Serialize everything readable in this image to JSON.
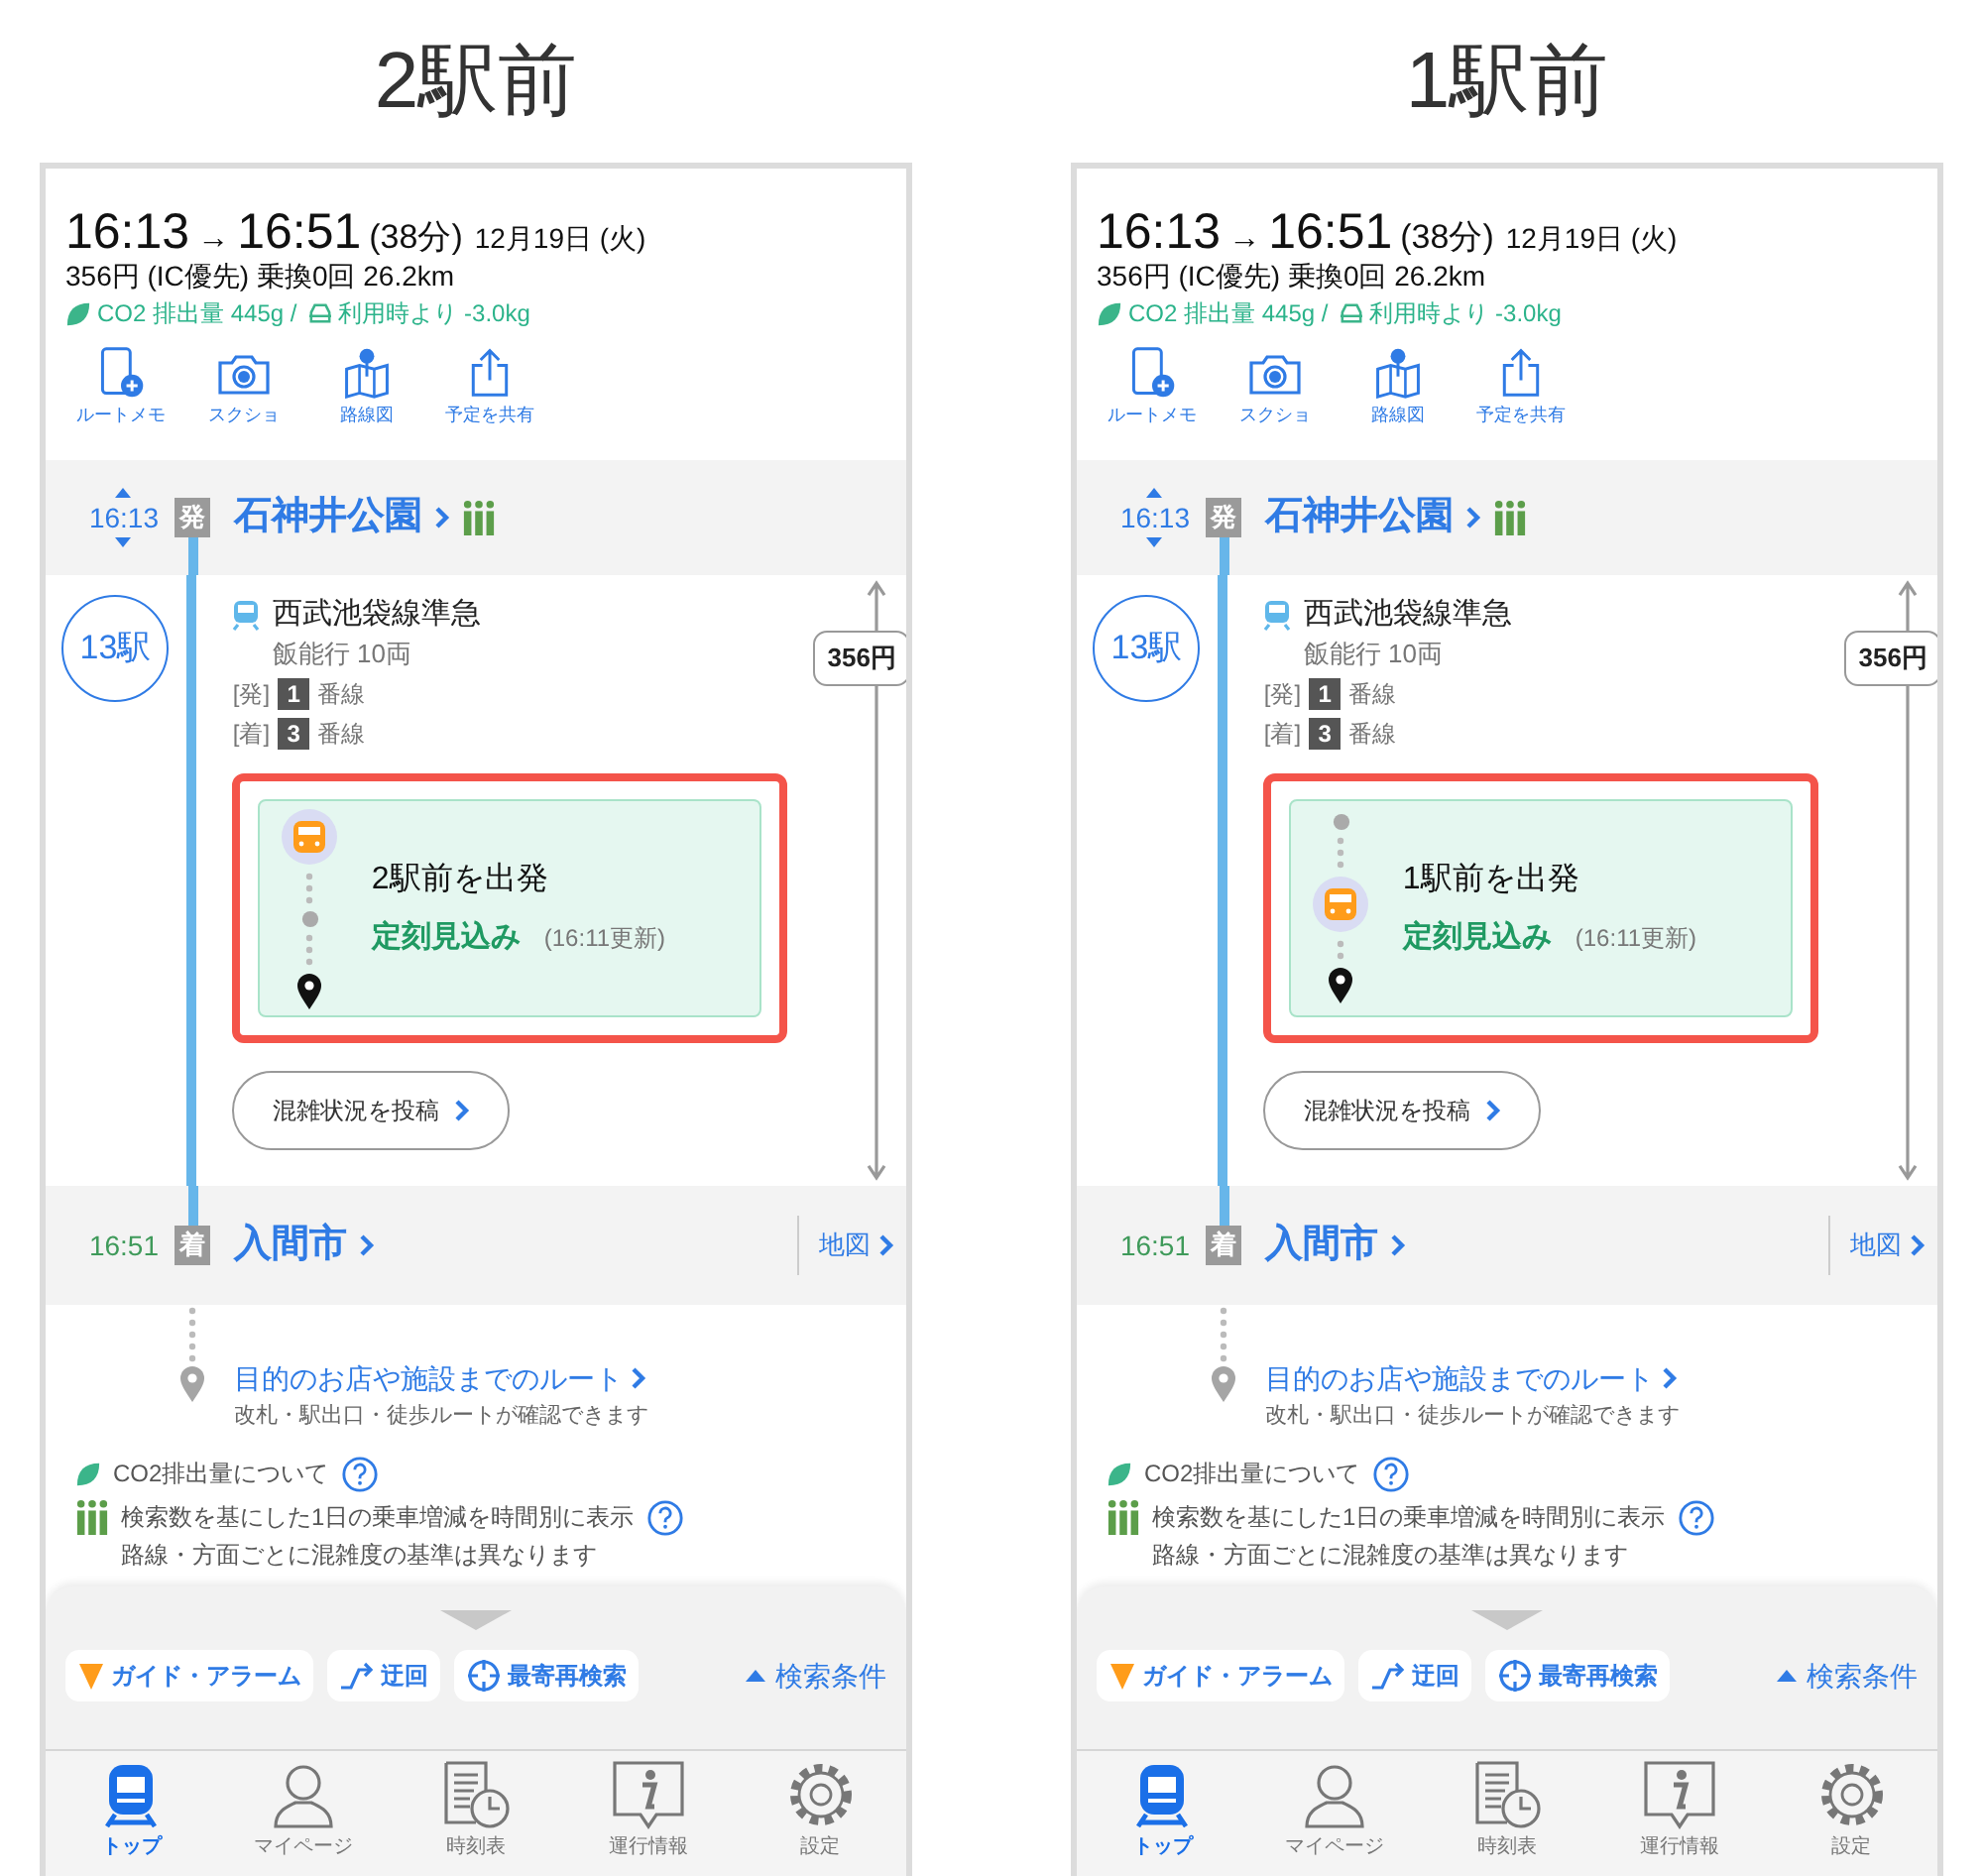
{
  "panels": [
    {
      "heading": "2駅前",
      "summary": {
        "depart": "16:13",
        "arrow": "→",
        "arrive": "16:51",
        "duration": "(38分)",
        "date": "12月19日 (火)",
        "fare": "356円 (IC優先) 乗換0回 26.2km",
        "co2": "CO2 排出量 445g /",
        "co2_saving": "利用時より -3.0kg"
      },
      "actions": [
        {
          "kind": "memo",
          "label": "ルートメモ"
        },
        {
          "kind": "camera",
          "label": "スクショ"
        },
        {
          "kind": "map",
          "label": "路線図"
        },
        {
          "kind": "share",
          "label": "予定を共有"
        }
      ],
      "departure": {
        "time": "16:13",
        "badge": "発",
        "station": "石神井公園"
      },
      "train": {
        "stops": "13駅",
        "line": "西武池袋線準急",
        "destination": "飯能行 10両",
        "platforms": [
          {
            "prefix": "[発]",
            "number": "1",
            "suffix": "番線"
          },
          {
            "prefix": "[着]",
            "number": "3",
            "suffix": "番線"
          }
        ],
        "fare": "356円"
      },
      "live": {
        "kind": "far",
        "status": "2駅前を出発",
        "punctuality": "定刻見込み",
        "updated": "(16:11更新)",
        "highlighted": true
      },
      "congestion_button": "混雑状況を投稿",
      "arrival": {
        "time": "16:51",
        "badge": "着",
        "station": "入間市",
        "map_link": "地図"
      },
      "destination_route": {
        "title": "目的のお店や施設までのルート",
        "subtitle": "改札・駅出口・徒歩ルートが確認できます"
      },
      "notes": [
        {
          "kind": "co2",
          "lines": [
            "CO2排出量について"
          ]
        },
        {
          "kind": "crowd",
          "lines": [
            "検索数を基にした1日の乗車増減を時間別に表示",
            "路線・方面ごとに混雑度の基準は異なります"
          ]
        }
      ],
      "toolbar": [
        {
          "kind": "alarm",
          "label": "ガイド・アラーム"
        },
        {
          "kind": "detour",
          "label": "迂回"
        },
        {
          "kind": "nearest",
          "label": "最寄再検索"
        }
      ],
      "search_conditions": "検索条件",
      "tabs": [
        {
          "kind": "train",
          "label": "トップ",
          "selected": true
        },
        {
          "kind": "person",
          "label": "マイページ",
          "selected": false
        },
        {
          "kind": "timetable",
          "label": "時刻表",
          "selected": false
        },
        {
          "kind": "info",
          "label": "運行情報",
          "selected": false
        },
        {
          "kind": "gear",
          "label": "設定",
          "selected": false
        }
      ]
    },
    {
      "heading": "1駅前",
      "summary": {
        "depart": "16:13",
        "arrow": "→",
        "arrive": "16:51",
        "duration": "(38分)",
        "date": "12月19日 (火)",
        "fare": "356円 (IC優先) 乗換0回 26.2km",
        "co2": "CO2 排出量 445g /",
        "co2_saving": "利用時より -3.0kg"
      },
      "actions": [
        {
          "kind": "memo",
          "label": "ルートメモ"
        },
        {
          "kind": "camera",
          "label": "スクショ"
        },
        {
          "kind": "map",
          "label": "路線図"
        },
        {
          "kind": "share",
          "label": "予定を共有"
        }
      ],
      "departure": {
        "time": "16:13",
        "badge": "発",
        "station": "石神井公園"
      },
      "train": {
        "stops": "13駅",
        "line": "西武池袋線準急",
        "destination": "飯能行 10両",
        "platforms": [
          {
            "prefix": "[発]",
            "number": "1",
            "suffix": "番線"
          },
          {
            "prefix": "[着]",
            "number": "3",
            "suffix": "番線"
          }
        ],
        "fare": "356円"
      },
      "live": {
        "kind": "near",
        "status": "1駅前を出発",
        "punctuality": "定刻見込み",
        "updated": "(16:11更新)",
        "highlighted": true
      },
      "congestion_button": "混雑状況を投稿",
      "arrival": {
        "time": "16:51",
        "badge": "着",
        "station": "入間市",
        "map_link": "地図"
      },
      "destination_route": {
        "title": "目的のお店や施設までのルート",
        "subtitle": "改札・駅出口・徒歩ルートが確認できます"
      },
      "notes": [
        {
          "kind": "co2",
          "lines": [
            "CO2排出量について"
          ]
        },
        {
          "kind": "crowd",
          "lines": [
            "検索数を基にした1日の乗車増減を時間別に表示",
            "路線・方面ごとに混雑度の基準は異なります"
          ]
        }
      ],
      "toolbar": [
        {
          "kind": "alarm",
          "label": "ガイド・アラーム"
        },
        {
          "kind": "detour",
          "label": "迂回"
        },
        {
          "kind": "nearest",
          "label": "最寄再検索"
        }
      ],
      "search_conditions": "検索条件",
      "tabs": [
        {
          "kind": "train",
          "label": "トップ",
          "selected": true
        },
        {
          "kind": "person",
          "label": "マイページ",
          "selected": false
        },
        {
          "kind": "timetable",
          "label": "時刻表",
          "selected": false
        },
        {
          "kind": "info",
          "label": "運行情報",
          "selected": false
        },
        {
          "kind": "gear",
          "label": "設定",
          "selected": false
        }
      ]
    }
  ]
}
